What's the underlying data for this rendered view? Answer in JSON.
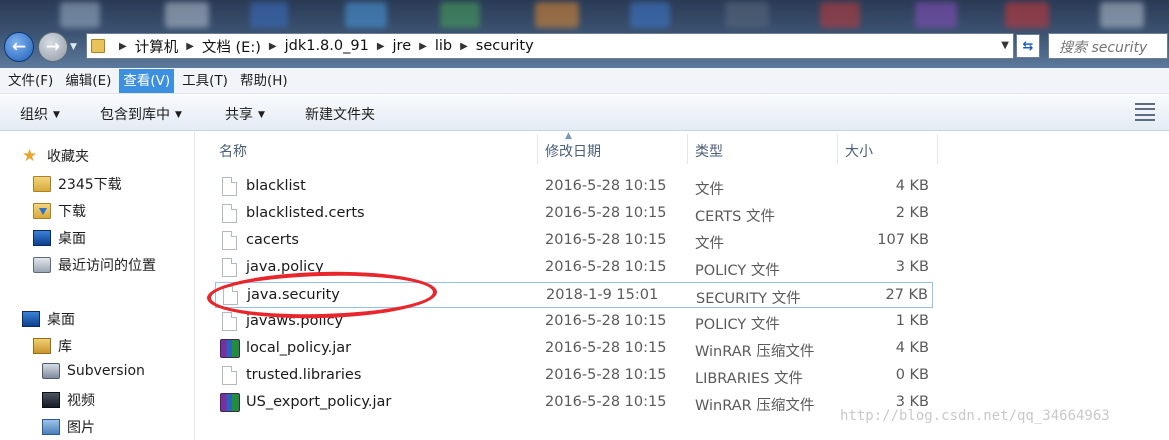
{
  "window": {
    "address_breadcrumbs": [
      "计算机",
      "文档 (E:)",
      "jdk1.8.0_91",
      "jre",
      "lib",
      "security"
    ],
    "search_placeholder": "搜索 security"
  },
  "menubar": {
    "items": [
      "文件(F)",
      "编辑(E)",
      "查看(V)",
      "工具(T)",
      "帮助(H)"
    ],
    "active_index": 2
  },
  "toolbar": {
    "organize": "组织",
    "include_in_library": "包含到库中",
    "share": "共享",
    "new_folder": "新建文件夹"
  },
  "nav": {
    "favorites_label": "收藏夹",
    "favorites": [
      "2345下载",
      "下载",
      "桌面",
      "最近访问的位置"
    ],
    "desktop_label": "桌面",
    "library_label": "库",
    "library_items": [
      "Subversion",
      "视频",
      "图片"
    ]
  },
  "columns": [
    "名称",
    "修改日期",
    "类型",
    "大小"
  ],
  "files": [
    {
      "name": "blacklist",
      "date": "2016-5-28 10:15",
      "type": "文件",
      "size": "4 KB",
      "icon": "file-icon"
    },
    {
      "name": "blacklisted.certs",
      "date": "2016-5-28 10:15",
      "type": "CERTS 文件",
      "size": "2 KB",
      "icon": "file-icon"
    },
    {
      "name": "cacerts",
      "date": "2016-5-28 10:15",
      "type": "文件",
      "size": "107 KB",
      "icon": "file-icon"
    },
    {
      "name": "java.policy",
      "date": "2016-5-28 10:15",
      "type": "POLICY 文件",
      "size": "3 KB",
      "icon": "file-icon"
    },
    {
      "name": "java.security",
      "date": "2018-1-9 15:01",
      "type": "SECURITY 文件",
      "size": "27 KB",
      "icon": "file-icon",
      "selected": true
    },
    {
      "name": "javaws.policy",
      "date": "2016-5-28 10:15",
      "type": "POLICY 文件",
      "size": "1 KB",
      "icon": "file-icon"
    },
    {
      "name": "local_policy.jar",
      "date": "2016-5-28 10:15",
      "type": "WinRAR 压缩文件",
      "size": "4 KB",
      "icon": "winrar-archive-icon"
    },
    {
      "name": "trusted.libraries",
      "date": "2016-5-28 10:15",
      "type": "LIBRARIES 文件",
      "size": "0 KB",
      "icon": "file-icon"
    },
    {
      "name": "US_export_policy.jar",
      "date": "2016-5-28 10:15",
      "type": "WinRAR 压缩文件",
      "size": "3 KB",
      "icon": "winrar-archive-icon"
    }
  ],
  "watermark": "http://blog.csdn.net/qq_34664963",
  "colors": {
    "menu_active": "#3d8fe0",
    "annotation": "#e8262c",
    "selection_border": "#99c0e8"
  }
}
